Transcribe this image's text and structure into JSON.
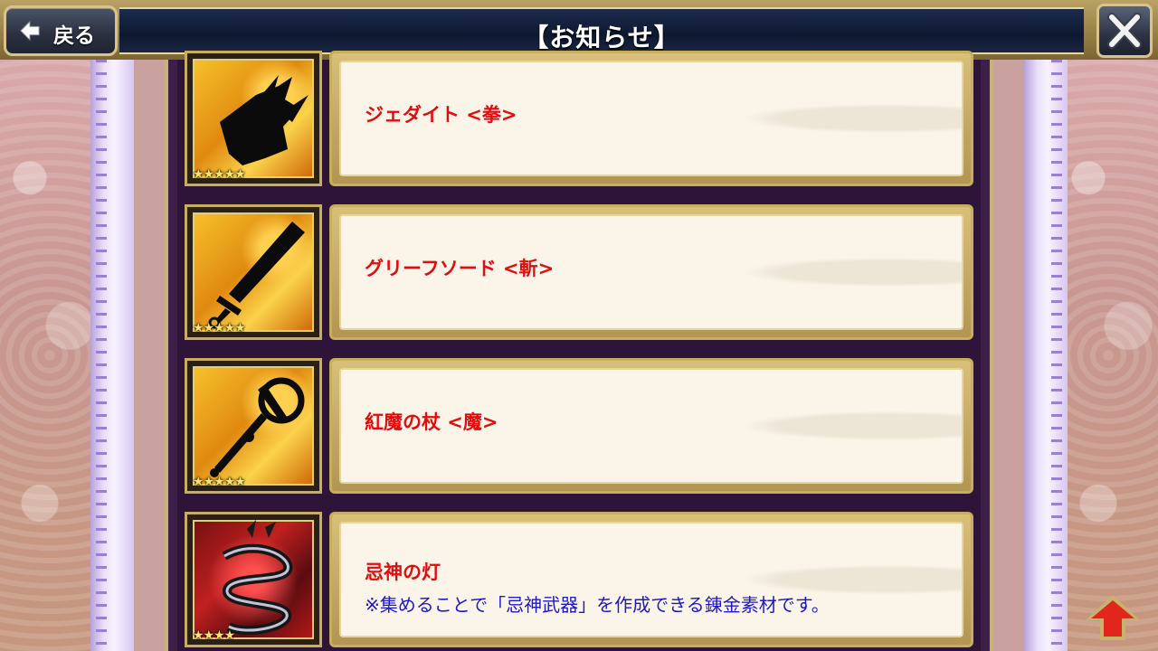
{
  "header": {
    "title": "【お知らせ】",
    "back_label": "戻る",
    "back_icon": "diamond-arrow-left",
    "close_icon": "x"
  },
  "items": [
    {
      "name": "ジェダイト <拳>",
      "stars": "★★★★★",
      "icon": "fist-weapon-icon"
    },
    {
      "name": "グリーフソード <斬>",
      "stars": "★★★★★",
      "icon": "sword-icon"
    },
    {
      "name": "紅魔の杖 <魔>",
      "stars": "★★★★★",
      "icon": "staff-icon"
    },
    {
      "name": "忌神の灯",
      "description": "※集めることで「忌神武器」を作成できる錬金素材です。",
      "stars": "★★★★",
      "icon": "spiral-lamp-icon"
    }
  ],
  "colors": {
    "name_red": "#e00d0d",
    "desc_blue": "#1d18c8",
    "header_navy": "#0e1830",
    "gold": "#c7ae5d",
    "panel_purple": "#2e1438"
  }
}
